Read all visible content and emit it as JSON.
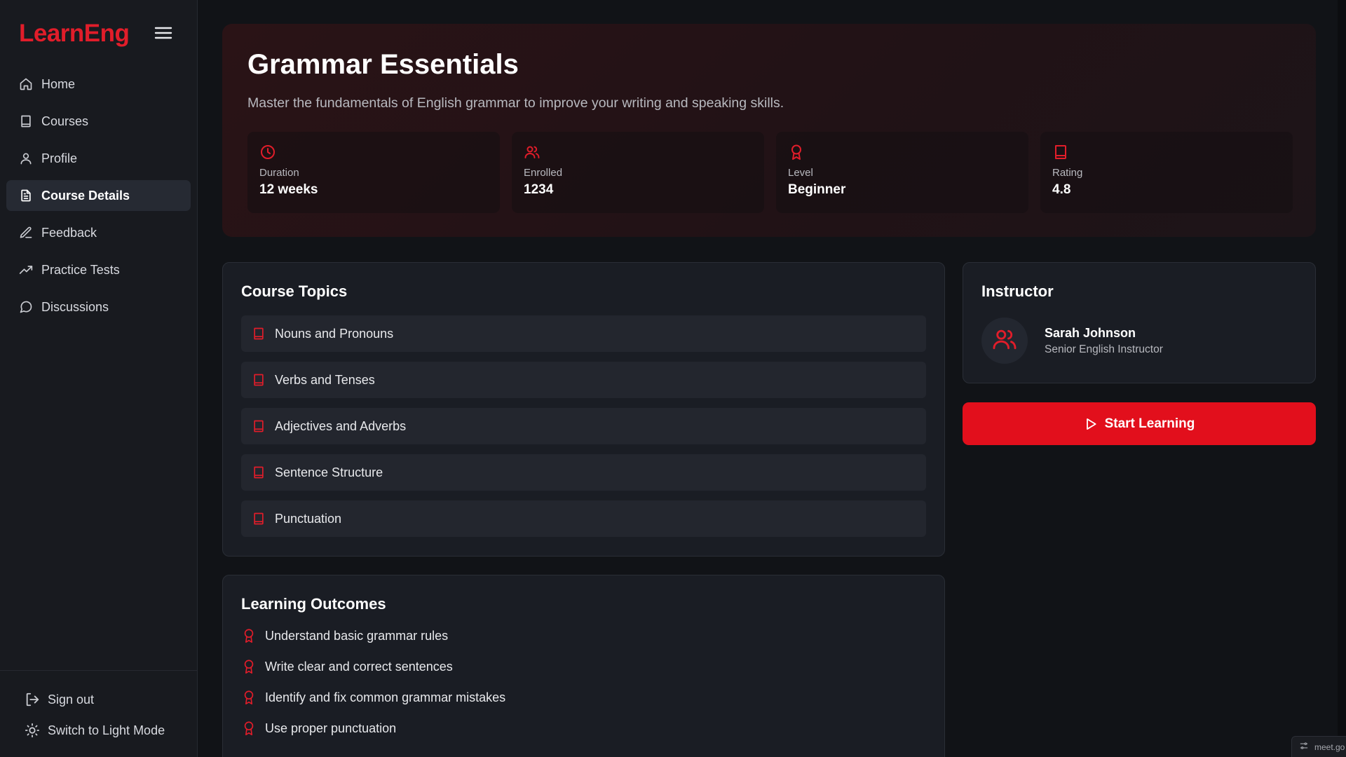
{
  "app": {
    "brand": "LearnEng",
    "accent_color": "#e11d2a",
    "menu_icon": "menu-icon"
  },
  "sidebar": {
    "items": [
      {
        "label": "Home",
        "icon": "home-icon",
        "active": false
      },
      {
        "label": "Courses",
        "icon": "book-icon",
        "active": false
      },
      {
        "label": "Profile",
        "icon": "user-icon",
        "active": false
      },
      {
        "label": "Course Details",
        "icon": "document-icon",
        "active": true
      },
      {
        "label": "Feedback",
        "icon": "pen-icon",
        "active": false
      },
      {
        "label": "Practice Tests",
        "icon": "trending-up-icon",
        "active": false
      },
      {
        "label": "Discussions",
        "icon": "chat-bubble-icon",
        "active": false
      }
    ],
    "footer": {
      "sign_out": "Sign out",
      "theme_toggle": "Switch to Light Mode"
    }
  },
  "course": {
    "title": "Grammar Essentials",
    "description": "Master the fundamentals of English grammar to improve your writing and speaking skills.",
    "stats": [
      {
        "label": "Duration",
        "value": "12 weeks",
        "icon": "clock-icon"
      },
      {
        "label": "Enrolled",
        "value": "1234",
        "icon": "users-icon"
      },
      {
        "label": "Level",
        "value": "Beginner",
        "icon": "award-icon"
      },
      {
        "label": "Rating",
        "value": "4.8",
        "icon": "book-icon"
      }
    ]
  },
  "topics": {
    "heading": "Course Topics",
    "items": [
      "Nouns and Pronouns",
      "Verbs and Tenses",
      "Adjectives and Adverbs",
      "Sentence Structure",
      "Punctuation"
    ]
  },
  "outcomes": {
    "heading": "Learning Outcomes",
    "items": [
      "Understand basic grammar rules",
      "Write clear and correct sentences",
      "Identify and fix common grammar mistakes",
      "Use proper punctuation"
    ]
  },
  "instructor": {
    "heading": "Instructor",
    "name": "Sarah Johnson",
    "title": "Senior English Instructor"
  },
  "actions": {
    "start_label": "Start Learning"
  },
  "corner_chip": {
    "label": "meet.go"
  }
}
